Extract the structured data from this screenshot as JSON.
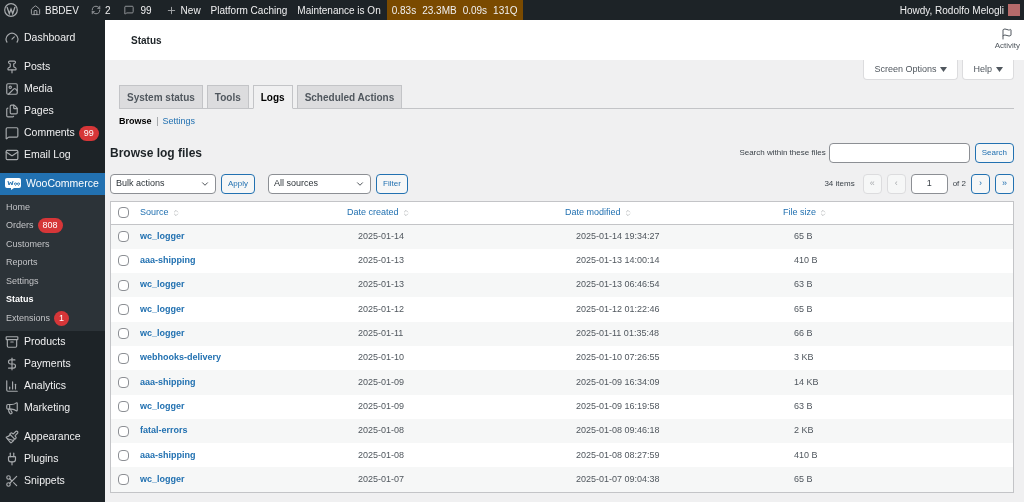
{
  "admin_bar": {
    "site": "BBDEV",
    "updates": "2",
    "comments": "99",
    "new": "New",
    "items": [
      "Platform Caching",
      "Maintenance is On"
    ],
    "stats": [
      "0.83s",
      "23.3MB",
      "0.09s",
      "131Q"
    ],
    "greeting": "Howdy, Rodolfo Melogli"
  },
  "header": {
    "title": "Status",
    "activity": "Activity"
  },
  "sidebar": {
    "items": [
      {
        "label": "Dashboard",
        "selected": false
      },
      {
        "label": "Posts",
        "selected": false
      },
      {
        "label": "Media",
        "selected": false
      },
      {
        "label": "Pages",
        "selected": false
      },
      {
        "label": "Comments",
        "selected": false,
        "badge": "99"
      },
      {
        "label": "Email Log",
        "selected": false
      },
      {
        "label": "WooCommerce",
        "selected": true,
        "children": [
          {
            "label": "Home",
            "selected": false
          },
          {
            "label": "Orders",
            "selected": false,
            "badge": "808"
          },
          {
            "label": "Customers",
            "selected": false
          },
          {
            "label": "Reports",
            "selected": false
          },
          {
            "label": "Settings",
            "selected": false
          },
          {
            "label": "Status",
            "selected": true
          },
          {
            "label": "Extensions",
            "selected": false,
            "badge": "1"
          }
        ]
      },
      {
        "label": "Products",
        "selected": false
      },
      {
        "label": "Payments",
        "selected": false
      },
      {
        "label": "Analytics",
        "selected": false
      },
      {
        "label": "Marketing",
        "selected": false
      },
      {
        "label": "Appearance",
        "selected": false
      },
      {
        "label": "Plugins",
        "selected": false
      },
      {
        "label": "Snippets",
        "selected": false
      }
    ]
  },
  "screen_buttons": [
    "Screen Options",
    "Help"
  ],
  "tabs": [
    {
      "label": "System status",
      "selected": false
    },
    {
      "label": "Tools",
      "selected": false
    },
    {
      "label": "Logs",
      "selected": true
    },
    {
      "label": "Scheduled Actions",
      "selected": false
    }
  ],
  "subnav": [
    {
      "label": "Browse",
      "selected": true
    },
    {
      "label": "Settings",
      "selected": false
    }
  ],
  "section_title": "Browse log files",
  "search": {
    "label": "Search within these files",
    "button": "Search"
  },
  "bulk": {
    "value": "Bulk actions",
    "button": "Apply"
  },
  "sources": {
    "value": "All sources",
    "button": "Filter"
  },
  "pagination": {
    "count": "34 items",
    "first": "«",
    "prev": "‹",
    "page": "1",
    "of": "of 2",
    "next": "›",
    "last": "»",
    "first_disabled": true,
    "prev_disabled": true
  },
  "table": {
    "select_all_checked": false,
    "columns": [
      "Source",
      "Date created",
      "Date modified",
      "File size"
    ],
    "rows": [
      {
        "checked": false,
        "cells": [
          "wc_logger",
          "2025-01-14",
          "2025-01-14 19:34:27",
          "65 B"
        ]
      },
      {
        "checked": false,
        "cells": [
          "aaa-shipping",
          "2025-01-13",
          "2025-01-13 14:00:14",
          "410 B"
        ]
      },
      {
        "checked": false,
        "cells": [
          "wc_logger",
          "2025-01-13",
          "2025-01-13 06:46:54",
          "63 B"
        ]
      },
      {
        "checked": false,
        "cells": [
          "wc_logger",
          "2025-01-12",
          "2025-01-12 01:22:46",
          "65 B"
        ]
      },
      {
        "checked": false,
        "cells": [
          "wc_logger",
          "2025-01-11",
          "2025-01-11 01:35:48",
          "66 B"
        ]
      },
      {
        "checked": false,
        "cells": [
          "webhooks-delivery",
          "2025-01-10",
          "2025-01-10 07:26:55",
          "3 KB"
        ]
      },
      {
        "checked": false,
        "cells": [
          "aaa-shipping",
          "2025-01-09",
          "2025-01-09 16:34:09",
          "14 KB"
        ]
      },
      {
        "checked": false,
        "cells": [
          "wc_logger",
          "2025-01-09",
          "2025-01-09 16:19:58",
          "63 B"
        ]
      },
      {
        "checked": false,
        "cells": [
          "fatal-errors",
          "2025-01-08",
          "2025-01-08 09:46:18",
          "2 KB"
        ]
      },
      {
        "checked": false,
        "cells": [
          "aaa-shipping",
          "2025-01-08",
          "2025-01-08 08:27:59",
          "410 B"
        ]
      },
      {
        "checked": false,
        "cells": [
          "wc_logger",
          "2025-01-07",
          "2025-01-07 09:04:38",
          "65 B"
        ]
      }
    ]
  }
}
